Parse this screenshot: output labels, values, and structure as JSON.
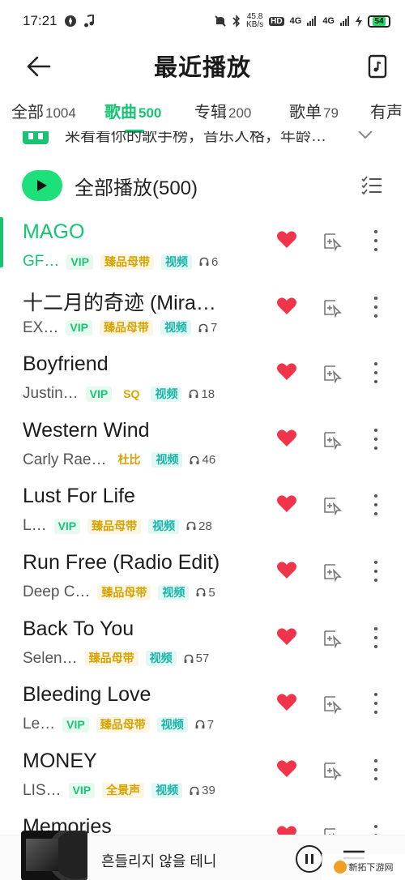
{
  "status": {
    "time": "17:21",
    "net_speed_value": "45.8",
    "net_speed_unit": "KB/s",
    "hd_label": "HD",
    "signal_1": "4G",
    "signal_2": "4G",
    "battery": "54"
  },
  "header": {
    "title": "最近播放"
  },
  "tabs": [
    {
      "label": "全部",
      "count": "1004"
    },
    {
      "label": "歌曲",
      "count": "500"
    },
    {
      "label": "专辑",
      "count": "200"
    },
    {
      "label": "歌单",
      "count": "79"
    },
    {
      "label": "有声",
      "count": ""
    }
  ],
  "banner": {
    "text": "来看看你的歌手榜，音乐人格，年龄…"
  },
  "play_all": {
    "label": "全部播放(500)"
  },
  "songs": [
    {
      "title": "MAGO",
      "artist": "GF…",
      "tags": [
        "VIP",
        "臻品母带",
        "视频"
      ],
      "listens": "6"
    },
    {
      "title": "十二月的奇迹 (Mira…",
      "artist": "EX…",
      "tags": [
        "VIP",
        "臻品母带",
        "视频"
      ],
      "listens": "7"
    },
    {
      "title": "Boyfriend",
      "artist": "Justin…",
      "tags": [
        "VIP",
        "SQ",
        "视频"
      ],
      "listens": "18"
    },
    {
      "title": "Western Wind",
      "artist": "Carly Rae…",
      "tags": [
        "杜比",
        "视频"
      ],
      "listens": "46"
    },
    {
      "title": "Lust For Life",
      "artist": "L…",
      "tags": [
        "VIP",
        "臻品母带",
        "视频"
      ],
      "listens": "28"
    },
    {
      "title": "Run Free (Radio Edit)",
      "artist": "Deep C…",
      "tags": [
        "臻品母带",
        "视频"
      ],
      "listens": "5"
    },
    {
      "title": "Back To You",
      "artist": "Selen…",
      "tags": [
        "臻品母带",
        "视频"
      ],
      "listens": "57"
    },
    {
      "title": "Bleeding Love",
      "artist": "Le…",
      "tags": [
        "VIP",
        "臻品母带",
        "视频"
      ],
      "listens": "7"
    },
    {
      "title": "MONEY",
      "artist": "LIS…",
      "tags": [
        "VIP",
        "全景声",
        "视频"
      ],
      "listens": "39"
    },
    {
      "title": "Memories",
      "artist": "",
      "tags": [],
      "listens": ""
    }
  ],
  "mini_player": {
    "now_playing": "흔들리지 않을 테니"
  },
  "watermark": {
    "text": "新拓下游网"
  },
  "colors": {
    "accent": "#16c472",
    "heart": "#f0344a"
  }
}
